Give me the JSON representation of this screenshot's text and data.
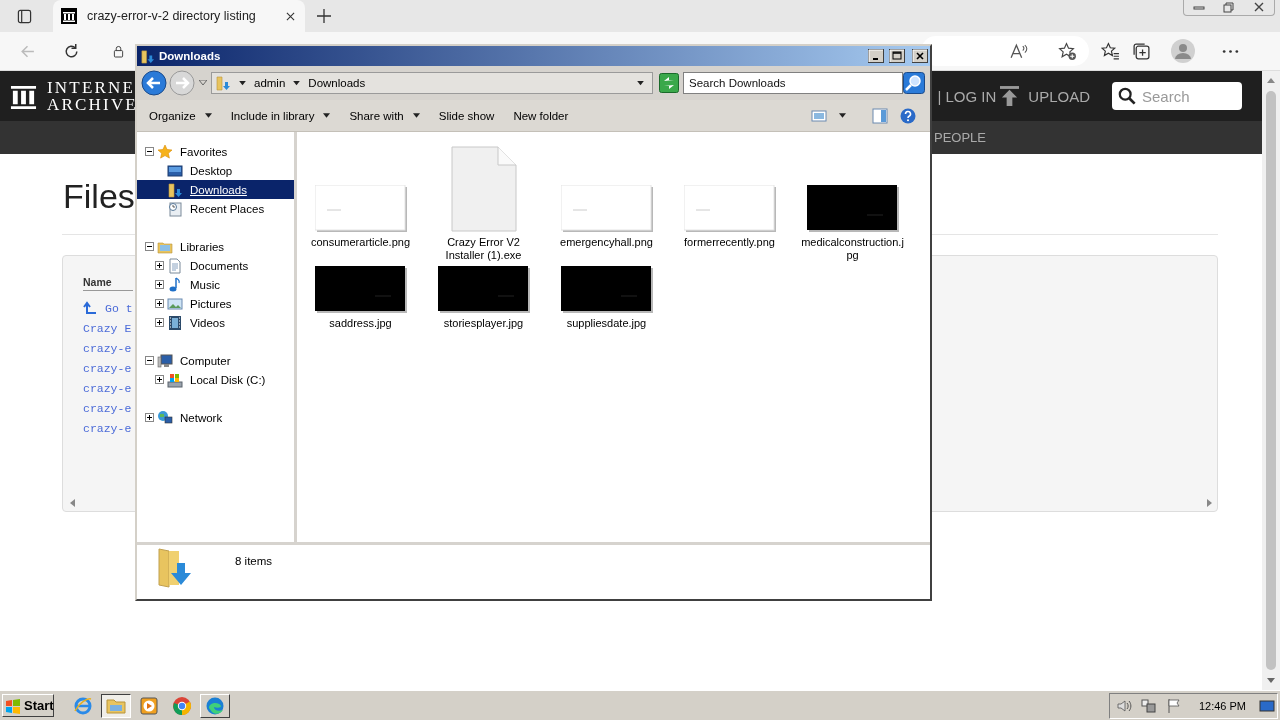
{
  "browser": {
    "tabs": [
      {
        "title": "crazy-error-v-2 directory listing",
        "selected": true
      }
    ],
    "page": {
      "logo": [
        "INTERNE",
        "ARCHIVE"
      ],
      "login": "| LOG IN",
      "upload": "UPLOAD",
      "search": {
        "placeholder": "Search"
      },
      "subnav": [
        "PEOPLE"
      ],
      "heading": "Files",
      "listing": {
        "column": "Name",
        "rows": [
          {
            "kind": "up",
            "text": "Go t"
          },
          {
            "kind": "file",
            "text": "Crazy E"
          },
          {
            "kind": "file",
            "text": "crazy-e"
          },
          {
            "kind": "file",
            "text": "crazy-e"
          },
          {
            "kind": "file",
            "text": "crazy-e"
          },
          {
            "kind": "file",
            "text": "crazy-e"
          },
          {
            "kind": "file",
            "text": "crazy-e"
          }
        ]
      }
    }
  },
  "explorer": {
    "title": "Downloads",
    "breadcrumb": [
      "admin",
      "Downloads"
    ],
    "search": {
      "placeholder": "Search Downloads"
    },
    "toolbar": [
      {
        "label": "Organize",
        "menu": true
      },
      {
        "label": "Include in library",
        "menu": true
      },
      {
        "label": "Share with",
        "menu": true
      },
      {
        "label": "Slide show",
        "menu": false
      },
      {
        "label": "New folder",
        "menu": false
      }
    ],
    "tree": [
      {
        "kind": "favorites",
        "label": "Favorites",
        "expanded": true,
        "selected": false,
        "children": [
          {
            "kind": "desktop",
            "label": "Desktop",
            "selected": false
          },
          {
            "kind": "downloads",
            "label": "Downloads",
            "selected": true
          },
          {
            "kind": "recent",
            "label": "Recent Places",
            "selected": false
          }
        ]
      },
      {
        "kind": "libraries",
        "label": "Libraries",
        "expanded": true,
        "selected": false,
        "children": [
          {
            "kind": "documents",
            "label": "Documents",
            "expanded": false,
            "selected": false
          },
          {
            "kind": "music",
            "label": "Music",
            "expanded": false,
            "selected": false
          },
          {
            "kind": "pictures",
            "label": "Pictures",
            "expanded": false,
            "selected": false
          },
          {
            "kind": "videos",
            "label": "Videos",
            "expanded": false,
            "selected": false
          }
        ]
      },
      {
        "kind": "computer",
        "label": "Computer",
        "expanded": true,
        "selected": false,
        "children": [
          {
            "kind": "disk",
            "label": "Local Disk (C:)",
            "expanded": false,
            "selected": false
          }
        ]
      },
      {
        "kind": "network",
        "label": "Network",
        "expanded": false,
        "selected": false
      }
    ],
    "files": [
      {
        "name": "consumerarticle.png",
        "kind": "light"
      },
      {
        "name": "Crazy Error V2 Installer (1).exe",
        "kind": "document"
      },
      {
        "name": "emergencyhall.png",
        "kind": "light"
      },
      {
        "name": "formerrecently.png",
        "kind": "light"
      },
      {
        "name": "medicalconstruction.jpg",
        "kind": "dark"
      },
      {
        "name": "saddress.jpg",
        "kind": "dark"
      },
      {
        "name": "storiesplayer.jpg",
        "kind": "dark"
      },
      {
        "name": "suppliesdate.jpg",
        "kind": "dark"
      }
    ],
    "status": "8 items"
  },
  "taskbar": {
    "start": "Start",
    "apps": [
      {
        "kind": "ie",
        "open": false,
        "selected": false
      },
      {
        "kind": "explorer",
        "open": true,
        "selected": true
      },
      {
        "kind": "media",
        "open": false,
        "selected": false
      },
      {
        "kind": "chrome",
        "open": false,
        "selected": false
      },
      {
        "kind": "edge",
        "open": true,
        "selected": false
      }
    ],
    "clock": "12:46 PM"
  }
}
